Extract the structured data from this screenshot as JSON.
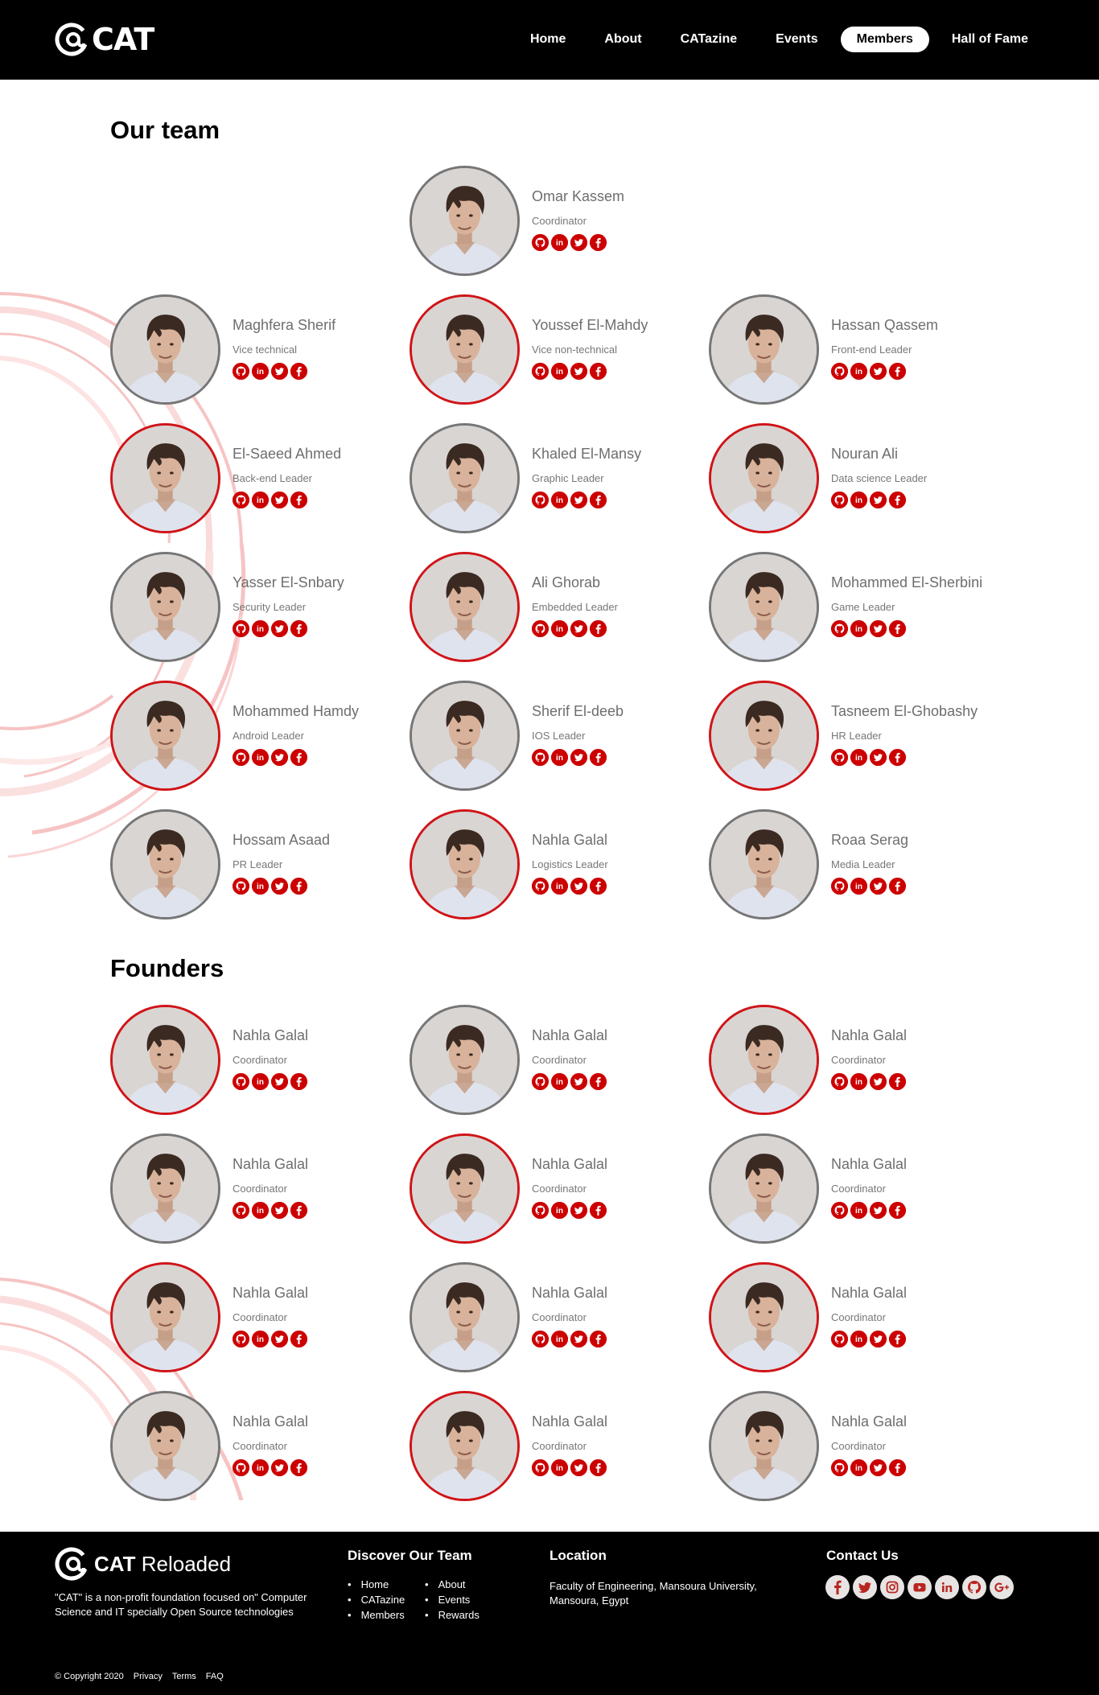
{
  "nav": {
    "logo_text": "CAT",
    "items": [
      {
        "label": "Home",
        "active": false
      },
      {
        "label": "About",
        "active": false
      },
      {
        "label": "CATazine",
        "active": false
      },
      {
        "label": "Events",
        "active": false
      },
      {
        "label": "Members",
        "active": true
      },
      {
        "label": "Hall of Fame",
        "active": false
      }
    ]
  },
  "team": {
    "title": "Our team",
    "members": [
      {
        "name": "Omar Kassem",
        "role": "Coordinator",
        "ring": "gray"
      },
      {
        "name": "Maghfera Sherif",
        "role": "Vice technical",
        "ring": "gray"
      },
      {
        "name": "Youssef El-Mahdy",
        "role": "Vice non-technical",
        "ring": "red"
      },
      {
        "name": "Hassan Qassem",
        "role": "Front-end Leader",
        "ring": "gray"
      },
      {
        "name": "El-Saeed Ahmed",
        "role": "Back-end Leader",
        "ring": "red"
      },
      {
        "name": "Khaled El-Mansy",
        "role": "Graphic Leader",
        "ring": "gray"
      },
      {
        "name": "Nouran Ali",
        "role": "Data science Leader",
        "ring": "red"
      },
      {
        "name": "Yasser El-Snbary",
        "role": "Security Leader",
        "ring": "gray"
      },
      {
        "name": "Ali Ghorab",
        "role": "Embedded Leader",
        "ring": "red"
      },
      {
        "name": "Mohammed El-Sherbini",
        "role": "Game Leader",
        "ring": "gray"
      },
      {
        "name": "Mohammed Hamdy",
        "role": "Android Leader",
        "ring": "red"
      },
      {
        "name": "Sherif El-deeb",
        "role": "IOS Leader",
        "ring": "gray"
      },
      {
        "name": "Tasneem El-Ghobashy",
        "role": "HR Leader",
        "ring": "red"
      },
      {
        "name": "Hossam Asaad",
        "role": "PR Leader",
        "ring": "gray"
      },
      {
        "name": "Nahla Galal",
        "role": "Logistics Leader",
        "ring": "red"
      },
      {
        "name": "Roaa Serag",
        "role": "Media Leader",
        "ring": "gray"
      }
    ]
  },
  "founders": {
    "title": "Founders",
    "members": [
      {
        "name": "Nahla Galal",
        "role": "Coordinator",
        "ring": "red"
      },
      {
        "name": "Nahla Galal",
        "role": "Coordinator",
        "ring": "gray"
      },
      {
        "name": "Nahla Galal",
        "role": "Coordinator",
        "ring": "red"
      },
      {
        "name": "Nahla Galal",
        "role": "Coordinator",
        "ring": "gray"
      },
      {
        "name": "Nahla Galal",
        "role": "Coordinator",
        "ring": "red"
      },
      {
        "name": "Nahla Galal",
        "role": "Coordinator",
        "ring": "gray"
      },
      {
        "name": "Nahla Galal",
        "role": "Coordinator",
        "ring": "red"
      },
      {
        "name": "Nahla Galal",
        "role": "Coordinator",
        "ring": "gray"
      },
      {
        "name": "Nahla Galal",
        "role": "Coordinator",
        "ring": "red"
      },
      {
        "name": "Nahla Galal",
        "role": "Coordinator",
        "ring": "gray"
      },
      {
        "name": "Nahla Galal",
        "role": "Coordinator",
        "ring": "red"
      },
      {
        "name": "Nahla Galal",
        "role": "Coordinator",
        "ring": "gray"
      }
    ]
  },
  "member_socials": [
    "github-icon",
    "linkedin-icon",
    "twitter-icon",
    "facebook-icon"
  ],
  "colors": {
    "accent": "#c00000",
    "ring_red": "#d01418",
    "ring_gray": "#767676",
    "nav_bg": "#000000"
  },
  "footer": {
    "logo_bold": "CAT",
    "logo_light": " Reloaded",
    "description": "\"CAT\" is a non-profit foundation focused on\" Computer Science and IT specially Open Source technologies",
    "discover": {
      "title": "Discover Our Team",
      "col1": [
        "Home",
        "CATazine",
        "Members"
      ],
      "col2": [
        "About",
        "Events",
        "Rewards"
      ]
    },
    "location": {
      "title": "Location",
      "text": "Faculty of Engineering, Mansoura University, Mansoura, Egypt"
    },
    "contact": {
      "title": "Contact Us",
      "icons": [
        "facebook-icon",
        "twitter-icon",
        "instagram-icon",
        "youtube-icon",
        "linkedin-icon",
        "github-icon",
        "google-plus-icon"
      ]
    },
    "copyright": "© Copyright 2020",
    "links": [
      "Privacy",
      "Terms",
      "FAQ"
    ]
  }
}
